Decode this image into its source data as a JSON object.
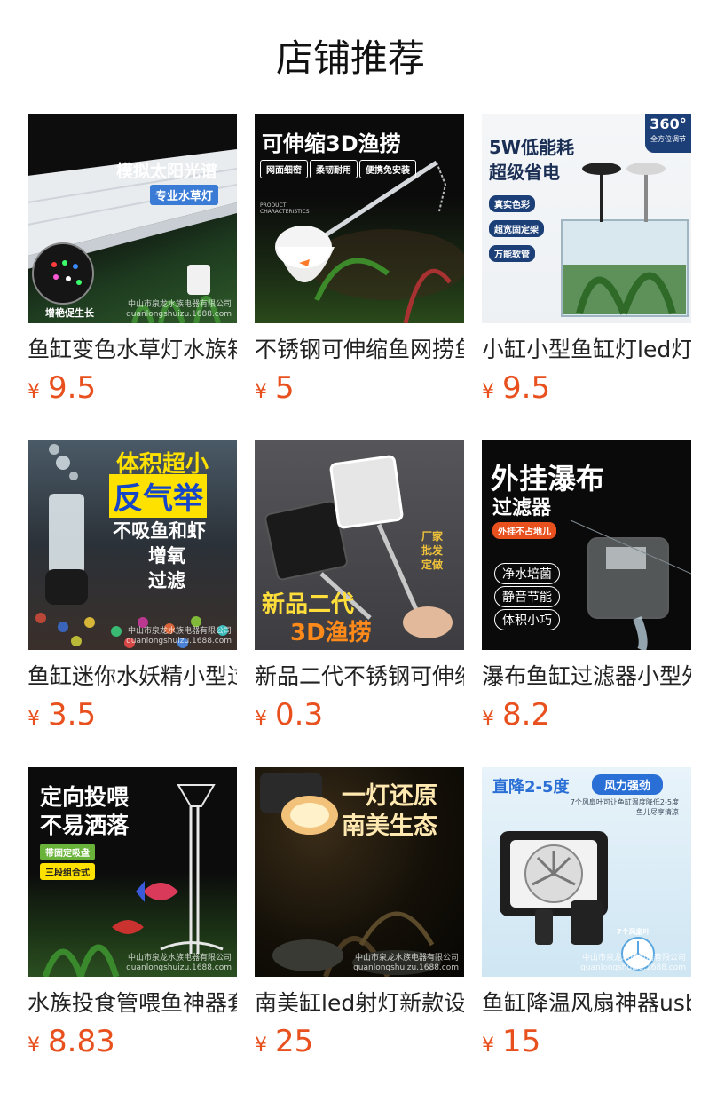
{
  "header": {
    "title": "店铺推荐"
  },
  "currency": "¥",
  "products": [
    {
      "title": "鱼缸变色水草灯水族箱",
      "price": "9.5",
      "image_text": {
        "headline": "模拟太阳光谱",
        "tag": "专业水草灯",
        "corner": "增艳促生长",
        "watermark_1": "中山市泉龙水族电器有限公司",
        "watermark_2": "quanlongshuizu.1688.com"
      }
    },
    {
      "title": "不锈钢可伸缩鱼网捞鱼网",
      "price": "5",
      "image_text": {
        "headline": "可伸缩3D渔捞",
        "tag_1": "网面细密",
        "tag_2": "柔韧耐用",
        "tag_3": "便携免安装",
        "small_1": "PRODUCT",
        "small_2": "CHARACTERISTICS"
      }
    },
    {
      "title": "小缸小型鱼缸灯led灯",
      "price": "9.5",
      "image_text": {
        "headline_1": "5W低能耗",
        "headline_2": "超级省电",
        "badge_1": "360°",
        "badge_2": "全方位调节",
        "tag_1": "真实色彩",
        "tag_2": "超宽固定架",
        "tag_3": "万能软管"
      }
    },
    {
      "title": "鱼缸迷你水妖精小型过滤器",
      "price": "3.5",
      "image_text": {
        "headline_1": "体积超小",
        "headline_2": "反气举",
        "line_1": "不吸鱼和虾",
        "line_2": "增氧",
        "line_3": "过滤",
        "watermark_1": "中山市泉龙水族电器有限公司",
        "watermark_2": "quanlongshuizu.1688.com"
      }
    },
    {
      "title": "新品二代不锈钢可伸缩渔捞",
      "price": "0.3",
      "image_text": {
        "side_1": "厂家",
        "side_2": "批发",
        "side_3": "定做",
        "headline_1": "新品二代",
        "headline_2": "3D渔捞"
      }
    },
    {
      "title": "瀑布鱼缸过滤器小型外挂",
      "price": "8.2",
      "image_text": {
        "headline_1": "外挂瀑布",
        "headline_2": "过滤器",
        "tag": "外挂不占地儿",
        "chip_1": "净水培菌",
        "chip_2": "静音节能",
        "chip_3": "体积小巧"
      }
    },
    {
      "title": "水族投食管喂鱼神器套装",
      "price": "8.83",
      "image_text": {
        "headline_1": "定向投喂",
        "headline_2": "不易洒落",
        "tag_1": "带固定吸盘",
        "tag_2": "三段组合式",
        "watermark_1": "中山市泉龙水族电器有限公司",
        "watermark_2": "quanlongshuizu.1688.com"
      }
    },
    {
      "title": "南美缸led射灯新款设计",
      "price": "25",
      "image_text": {
        "headline_1": "一灯还原",
        "headline_2": "南美生态",
        "watermark_1": "中山市泉龙水族电器有限公司",
        "watermark_2": "quanlongshuizu.1688.com"
      }
    },
    {
      "title": "鱼缸降温风扇神器usb",
      "price": "15",
      "image_text": {
        "headline": "直降2-5度",
        "badge": "风力强劲",
        "sub_1": "7个风扇叶可让鱼缸温度降低2-5度",
        "sub_2": "鱼儿尽享清凉",
        "fan_label": "7个风扇叶",
        "watermark_1": "中山市泉龙水族电器有限公司",
        "watermark_2": "quanlongshuizu.1688.com"
      }
    }
  ],
  "colors": {
    "price": "#e8501e",
    "title": "#222222"
  }
}
